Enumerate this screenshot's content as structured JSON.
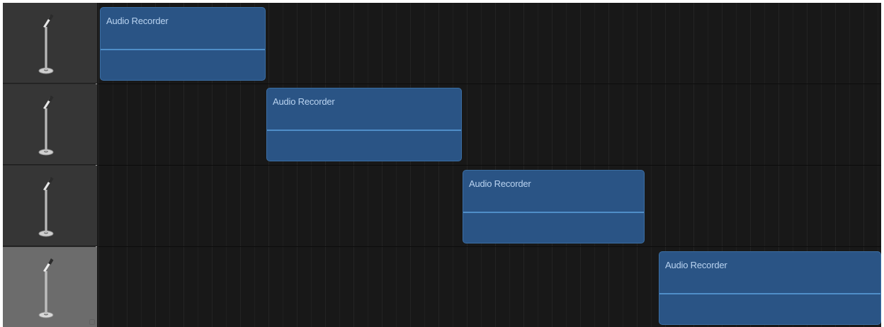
{
  "tracks": [
    {
      "icon": "microphone-icon",
      "region_label": "Audio Recorder",
      "selected": false
    },
    {
      "icon": "microphone-icon",
      "region_label": "Audio Recorder",
      "selected": false
    },
    {
      "icon": "microphone-icon",
      "region_label": "Audio Recorder",
      "selected": false
    },
    {
      "icon": "microphone-icon",
      "region_label": "Audio Recorder",
      "selected": true
    }
  ],
  "colors": {
    "region_fill": "#2a5485",
    "region_line": "#4f8ec8",
    "region_text": "#b9d3f0",
    "header_bg": "#363636",
    "header_selected_bg": "#6c6c6c",
    "timeline_bg": "#181818"
  }
}
